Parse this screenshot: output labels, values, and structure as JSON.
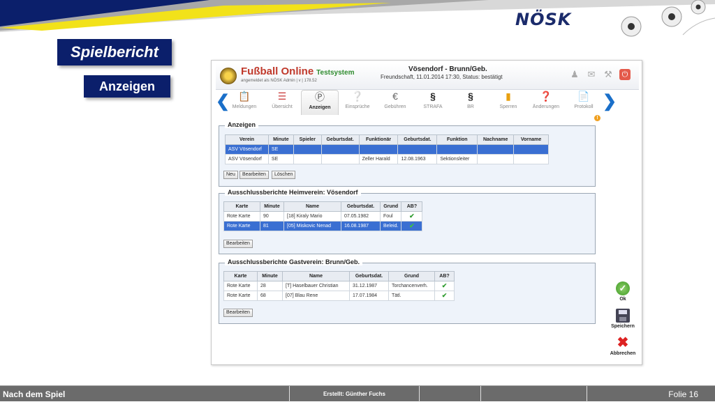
{
  "slide": {
    "title": "Spielbericht",
    "subtitle": "Anzeigen",
    "brand": "NÖSK"
  },
  "app": {
    "title": "Fußball Online",
    "system": "Testsystem",
    "login": "angemeldet als NÖSK Admin | v | 178.52",
    "match_title": "Vösendorf - Brunn/Geb.",
    "match_info": "Freundschaft, 11.01.2014 17:30, Status: bestätigt"
  },
  "toolbar": [
    {
      "label": "Meldungen",
      "icon": "clipboard-icon"
    },
    {
      "label": "Übersicht",
      "icon": "list-icon"
    },
    {
      "label": "Anzeigen",
      "icon": "report-icon"
    },
    {
      "label": "Einsprüche",
      "icon": "objection-icon"
    },
    {
      "label": "Gebühren",
      "icon": "euro-icon"
    },
    {
      "label": "STRAFA",
      "icon": "paragraph-icon"
    },
    {
      "label": "BR",
      "icon": "paragraph-score-icon"
    },
    {
      "label": "Sperren",
      "icon": "cards-icon"
    },
    {
      "label": "Änderungen",
      "icon": "help-icon"
    },
    {
      "label": "Protokoll",
      "icon": "document-icon"
    }
  ],
  "anzeigen": {
    "legend": "Anzeigen",
    "columns": [
      "Verein",
      "Minute",
      "Spieler",
      "Geburtsdat.",
      "Funktionär",
      "Geburtsdat.",
      "Funktion",
      "Nachname",
      "Vorname"
    ],
    "rows": [
      [
        "ASV Vösendorf",
        "SE",
        "",
        "",
        "",
        "",
        "",
        "",
        ""
      ],
      [
        "ASV Vösendorf",
        "SE",
        "",
        "",
        "Zeller Harald",
        "12.08.1963",
        "Sektionsleiter",
        "",
        ""
      ]
    ],
    "buttons": {
      "new": "Neu",
      "edit": "Bearbeiten",
      "delete": "Löschen"
    }
  },
  "heim": {
    "legend": "Ausschlussberichte Heimverein: Vösendorf",
    "columns": [
      "Karte",
      "Minute",
      "Name",
      "Geburtsdat.",
      "Grund",
      "AB?"
    ],
    "rows": [
      [
        "Rote Karte",
        "90",
        "[18] Kiraly Mario",
        "07.05.1982",
        "Foul",
        "✔"
      ],
      [
        "Rote Karte",
        "81",
        "[05] Miskovic Nenad",
        "16.08.1987",
        "Beleid.",
        "✔"
      ]
    ],
    "edit": "Bearbeiten"
  },
  "gast": {
    "legend": "Ausschlussberichte Gastverein: Brunn/Geb.",
    "columns": [
      "Karte",
      "Minute",
      "Name",
      "Geburtsdat.",
      "Grund",
      "AB?"
    ],
    "rows": [
      [
        "Rote Karte",
        "28",
        "[T] Haselbauer Christian",
        "31.12.1987",
        "Torchancenverh.",
        "✔"
      ],
      [
        "Rote Karte",
        "68",
        "[07] Blau Rene",
        "17.07.1984",
        "Tätl.",
        "✔"
      ]
    ],
    "edit": "Bearbeiten"
  },
  "actions": {
    "ok": "Ok",
    "save": "Speichern",
    "cancel": "Abbrechen"
  },
  "footer": {
    "section": "Nach dem Spiel",
    "author": "Erstellt: Günther Fuchs",
    "folie": "Folie  16"
  }
}
